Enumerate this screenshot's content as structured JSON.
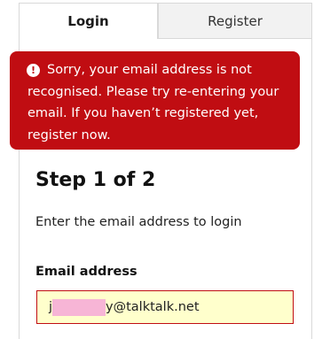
{
  "tabs": {
    "login_label": "Login",
    "register_label": "Register"
  },
  "alert": {
    "icon": "exclamation-icon",
    "message": "Sorry, your email address is not recognised. Please try re-entering your email. If you haven’t registered yet, register now."
  },
  "step": {
    "title": "Step 1 of 2",
    "instruction": "Enter the email address to login"
  },
  "email": {
    "label": "Email address",
    "value_prefix": "j",
    "value_suffix": "y@talktalk.net"
  },
  "colors": {
    "alert_background": "#c00d12",
    "input_background": "#ffffcc",
    "input_border": "#c00d12",
    "redaction": "#f7b5d6"
  }
}
